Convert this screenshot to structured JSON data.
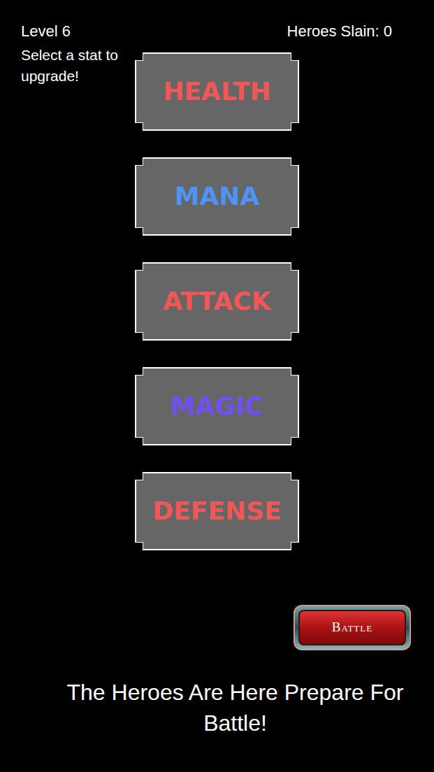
{
  "header": {
    "level": "Level 6",
    "heroes_slain": "Heroes Slain: 0"
  },
  "prompt": "Select a stat to upgrade!",
  "stats": [
    {
      "label": "HEALTH",
      "color": "#f25757"
    },
    {
      "label": "MANA",
      "color": "#4f94f5"
    },
    {
      "label": "ATTACK",
      "color": "#f25757"
    },
    {
      "label": "MAGIC",
      "color": "#7050f5"
    },
    {
      "label": "DEFENSE",
      "color": "#f25757"
    }
  ],
  "battle_button": "Battle",
  "message": "The Heroes Are Here Prepare For Battle!"
}
